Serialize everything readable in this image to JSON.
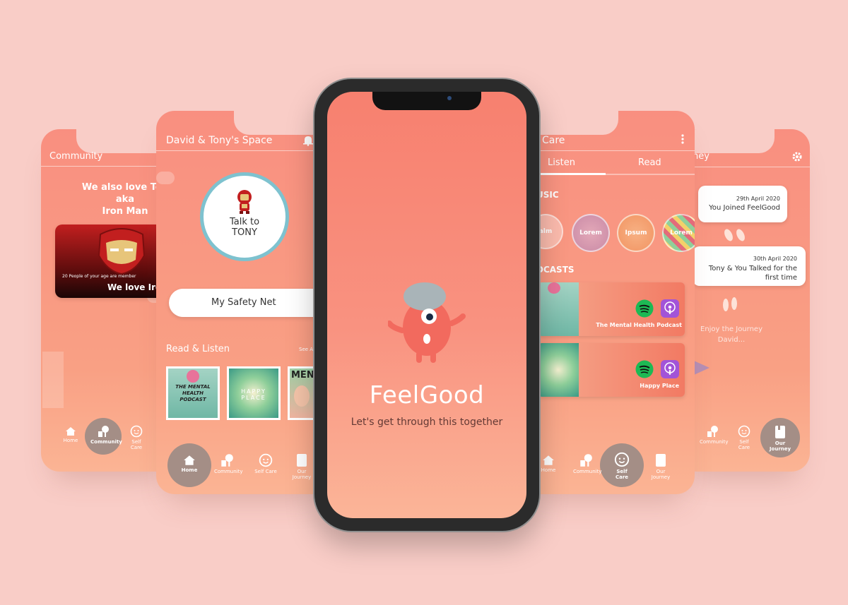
{
  "colors": {
    "background": "#f9cdc7",
    "screen_top": "#f98f80",
    "screen_bottom": "#fbb494",
    "accent_teal": "#7ec2cf",
    "nav_active": "#a48e86"
  },
  "community": {
    "header": "Community",
    "title_lines": [
      "We also love Ton",
      "aka",
      "Iron Man"
    ],
    "card_small": "20 People of your age are member",
    "card_big": "We love Iron",
    "nav": [
      "Home",
      "Community",
      "Self Care"
    ]
  },
  "space": {
    "header": "David & Tony's Space",
    "talk_line1": "Talk to",
    "talk_line2": "TONY",
    "safety_net": "My Safety Net",
    "read_listen": "Read & Listen",
    "see_all": "See All",
    "covers": [
      {
        "text": "THE MENTAL HEALTH PODCAST"
      },
      {
        "text": "HAPPY PLACE"
      },
      {
        "text": "MEN"
      }
    ],
    "nav": [
      "Home",
      "Community",
      "Self Care",
      "Our Journey"
    ]
  },
  "splash": {
    "app_name": "FeelGood",
    "tagline": "Let's get through this together"
  },
  "selfcare": {
    "header": "Care",
    "tabs": [
      "Listen",
      "Read"
    ],
    "music_label": "USIC",
    "music_items": [
      "alm",
      "Lorem",
      "Ipsum",
      "Lorem"
    ],
    "podcasts_label": "DCASTS",
    "podcast_items": [
      "The Mental Health Podcast",
      "Happy Place"
    ],
    "nav": [
      "Home",
      "Community",
      "Self Care",
      "Our Journey"
    ]
  },
  "journey": {
    "header": "ney",
    "events": [
      {
        "date": "29th April 2020",
        "text": "You Joined FeelGood"
      },
      {
        "date": "30th April 2020",
        "text": "Tony & You Talked for the first time"
      }
    ],
    "footer_line1": "Enjoy the Journey",
    "footer_line2": "David...",
    "nav": [
      "Community",
      "Self Care",
      "Our Journey"
    ]
  }
}
